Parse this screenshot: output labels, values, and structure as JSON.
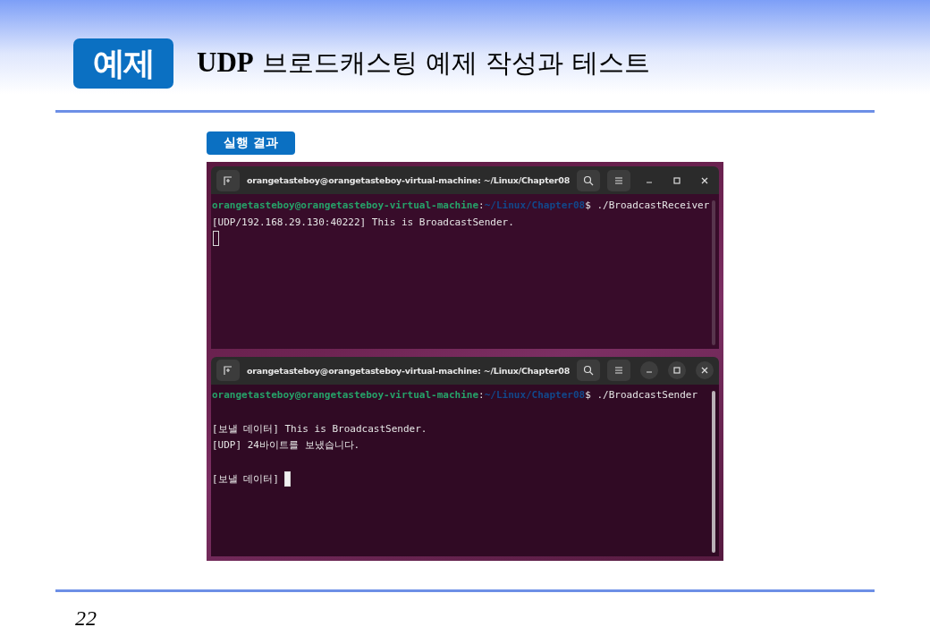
{
  "header": {
    "badge": "예제",
    "title": "**UDP** 브로드캐스팅 예제 작성과 테스트"
  },
  "section_label": "실행 결과",
  "terminals": [
    {
      "title": "orangetasteboy@orangetasteboy-virtual-machine: ~/Linux/Chapter08",
      "focused": false,
      "lines": [
        {
          "kind": "prompt",
          "user": "orangetasteboy@orangetasteboy-virtual-machine",
          "colon": ":",
          "path": "~/Linux/Chapter08",
          "command": "$ ./BroadcastReceiver"
        },
        {
          "kind": "output",
          "text": "[UDP/192.168.29.130:40222] This is BroadcastSender."
        },
        {
          "kind": "cursor"
        }
      ]
    },
    {
      "title": "orangetasteboy@orangetasteboy-virtual-machine: ~/Linux/Chapter08",
      "focused": true,
      "lines": [
        {
          "kind": "prompt",
          "user": "orangetasteboy@orangetasteboy-virtual-machine",
          "colon": ":",
          "path": "~/Linux/Chapter08",
          "command": "$ ./BroadcastSender"
        },
        {
          "kind": "blank"
        },
        {
          "kind": "output",
          "text": "[보낼 데이터] This is BroadcastSender."
        },
        {
          "kind": "output",
          "text": "[UDP] 24바이트를 보냈습니다."
        },
        {
          "kind": "blank"
        },
        {
          "kind": "input",
          "text": "[보낼 데이터]"
        }
      ]
    }
  ],
  "page_number": "22"
}
